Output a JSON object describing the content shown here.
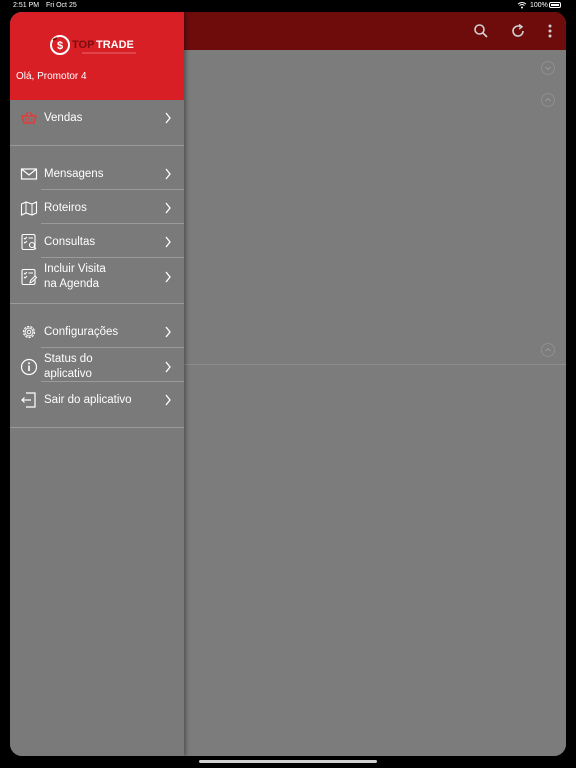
{
  "status_bar": {
    "time": "2:51 PM",
    "date": "Fri Oct 25",
    "battery": "100%"
  },
  "drawer": {
    "brand": "TOPTRADE",
    "brand_colors": {
      "header": "#d91f26",
      "top": "#c41a1a",
      "trade": "#ffffff"
    },
    "greeting": "Olá, Promotor 4",
    "items": [
      {
        "label": "Vendas",
        "icon": "basket-icon"
      },
      {
        "label": "Mensagens",
        "icon": "envelope-icon"
      },
      {
        "label": "Roteiros",
        "icon": "map-icon"
      },
      {
        "label": "Consultas",
        "icon": "search-list-icon"
      },
      {
        "label": "Incluir Visita",
        "label2": "na Agenda",
        "icon": "edit-checklist-icon"
      },
      {
        "label": "Configurações",
        "icon": "gear-icon"
      },
      {
        "label": "Status do",
        "label2": "aplicativo",
        "icon": "info-icon"
      },
      {
        "label": "Sair do aplicativo",
        "icon": "logout-icon"
      }
    ]
  },
  "appbar": {
    "color": "#6e0c0c",
    "actions": [
      "search-icon",
      "refresh-icon",
      "more-vert-icon"
    ]
  }
}
